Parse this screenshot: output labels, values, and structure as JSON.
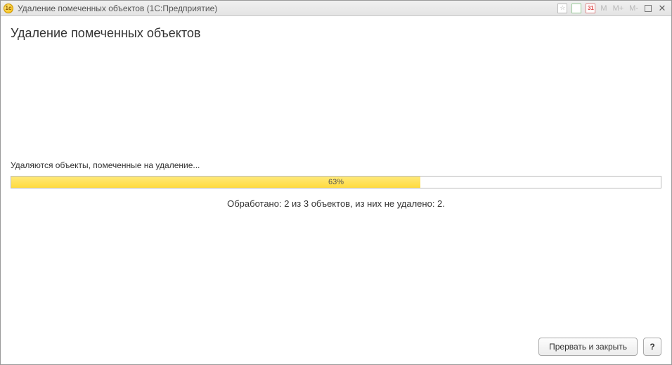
{
  "titlebar": {
    "app_icon_text": "1c",
    "title": "Удаление помеченных объектов  (1С:Предприятие)",
    "calendar_icon_text": "31",
    "m_label": "M",
    "m_plus_label": "M+",
    "m_minus_label": "M-"
  },
  "page": {
    "heading": "Удаление помеченных объектов"
  },
  "progress": {
    "status_text": "Удаляются объекты, помеченные на удаление...",
    "percent_label": "63%",
    "percent_value": 63,
    "processed_text": "Обработано: 2 из 3 объектов, из них не удалено: 2."
  },
  "footer": {
    "abort_label": "Прервать и закрыть",
    "help_label": "?"
  }
}
